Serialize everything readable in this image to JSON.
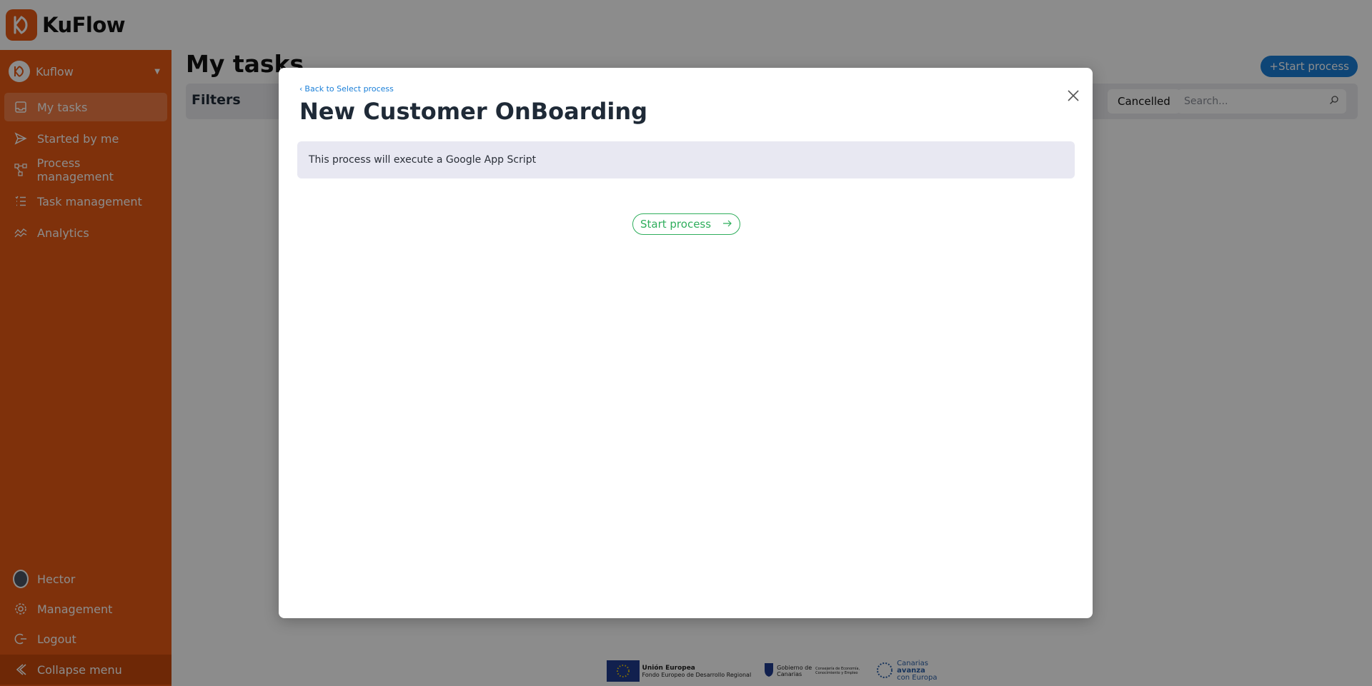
{
  "app": {
    "logo_text": "KuFlow"
  },
  "sidebar": {
    "tenant_name": "Kuflow",
    "items": [
      {
        "label": "My tasks",
        "icon": "inbox-icon",
        "active": true
      },
      {
        "label": "Started by me",
        "icon": "send-icon"
      },
      {
        "label": "Process management",
        "icon": "process-icon"
      },
      {
        "label": "Task management",
        "icon": "checklist-icon"
      },
      {
        "label": "Analytics",
        "icon": "analytics-icon"
      }
    ],
    "bottom": {
      "user_name": "Hector",
      "management": "Management",
      "logout": "Logout",
      "collapse": "Collapse menu"
    }
  },
  "main": {
    "title": "My tasks",
    "start_process_label": "Start process",
    "filters_label": "Filters",
    "cancelled_label": "Cancelled",
    "search_placeholder": "Search..."
  },
  "modal": {
    "back_label": "Back to Select process",
    "title": "New Customer OnBoarding",
    "description": "This process will execute a Google App Script",
    "start_label": "Start process"
  },
  "footer": {
    "eu_title": "Unión Europea",
    "eu_sub": "Fondo Europeo de Desarrollo Regional",
    "gob_name": "Gobierno de Canarias",
    "gob_sub": "Consejería de Economía, Conocimiento y Empleo",
    "canarias_line1": "Canarias",
    "canarias_line2": "avanza",
    "canarias_line3": "con Europa"
  },
  "colors": {
    "brand": "#e85a14",
    "accent_blue": "#1a7fd8",
    "success_green": "#2fae5c"
  }
}
